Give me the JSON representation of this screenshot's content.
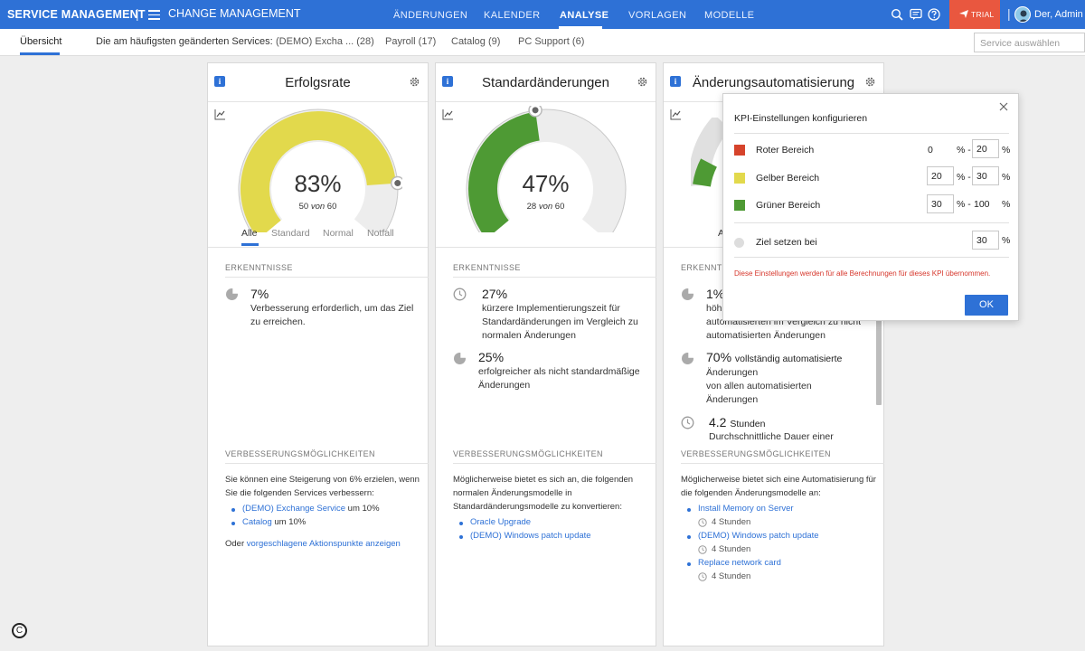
{
  "topbar": {
    "brand": "SERVICE MANAGEMENT",
    "separator": "|",
    "module": "CHANGE MANAGEMENT",
    "nav": [
      "ÄNDERUNGEN",
      "KALENDER",
      "ANALYSE",
      "VORLAGEN",
      "MODELLE"
    ],
    "trial": "TRIAL",
    "user": "Der, Admin",
    "accent_color": "#2e71d6",
    "trial_color": "#e9573f"
  },
  "subbar": {
    "overview": "Übersicht",
    "most_changed": "Die am häufigsten geänderten Services:",
    "services": [
      "(DEMO) Excha ... (28)",
      "Payroll (17)",
      "Catalog (9)",
      "PC Support (6)"
    ],
    "service_select_placeholder": "Service auswählen"
  },
  "cards": [
    {
      "title": "Erfolgsrate",
      "value": "83%",
      "ratio_a": "50",
      "ratio_von": "von",
      "ratio_b": "60",
      "fraction": 0.83,
      "gauge_color": "#e2d94c",
      "tabs": [
        "Alle",
        "Standard",
        "Normal",
        "Notfall"
      ],
      "insights_label": "ERKENNTNISSE",
      "insights": [
        {
          "icon": "pie-chart-icon",
          "big": "7%",
          "text": "Verbesserung erforderlich, um das Ziel zu erreichen."
        }
      ],
      "improve_label": "VERBESSERUNGSMÖGLICHKEITEN",
      "improve_text": "Sie können eine Steigerung von 6% erzielen, wenn Sie die folgenden Services verbessern:",
      "links": [
        {
          "text": "(DEMO) Exchange Service",
          "suffix": " um 10%"
        },
        {
          "text": "Catalog",
          "suffix": " um 10%"
        }
      ],
      "footer_prefix": "Oder ",
      "footer_link": "vorgeschlagene Aktionspunkte anzeigen"
    },
    {
      "title": "Standardänderungen",
      "value": "47%",
      "ratio_a": "28",
      "ratio_von": "von",
      "ratio_b": "60",
      "fraction": 0.47,
      "gauge_color": "#4e9a34",
      "insights_label": "ERKENNTNISSE",
      "insights": [
        {
          "icon": "clock-icon",
          "big": "27%",
          "text": "kürzere Implementierungszeit für Standardänderungen im Vergleich zu normalen Änderungen"
        },
        {
          "icon": "pie-chart-icon",
          "big": "25%",
          "text": "erfolgreicher als nicht standardmäßige Änderungen"
        }
      ],
      "improve_label": "VERBESSERUNGSMÖGLICHKEITEN",
      "improve_text": "Möglicherweise bietet es sich an, die folgenden normalen Änderungsmodelle in Standardänderungsmodelle zu konvertieren:",
      "links": [
        {
          "text": "Oracle Upgrade",
          "suffix": ""
        },
        {
          "text": "(DEMO) Windows patch update",
          "suffix": ""
        }
      ]
    },
    {
      "title": "Änderungsautomatisierung",
      "tab_partial": "A",
      "gauge_color": "#4e9a34",
      "insights_label": "ERKENNTNISSE",
      "insights": [
        {
          "icon": "pie-chart-icon",
          "big": "1%",
          "line1": "höhe",
          "line2": "automatisierten im Vergleich zu nicht",
          "line3": "automatisierten Änderungen"
        },
        {
          "icon": "pie-chart-icon",
          "big": "70%",
          "inline": "vollständig automatisierte",
          "line1": "Änderungen",
          "line2": "von allen automatisierten",
          "line3": "Änderungen"
        },
        {
          "icon": "clock-icon",
          "big": "4.2",
          "inline": "Stunden",
          "line1": "Durchschnittliche Dauer einer"
        }
      ],
      "improve_label": "VERBESSERUNGSMÖGLICHKEITEN",
      "improve_text": "Möglicherweise bietet sich eine Automatisierung für die folgenden Änderungsmodelle an:",
      "links": [
        {
          "text": "Install Memory on Server",
          "duration": "4 Stunden"
        },
        {
          "text": "(DEMO) Windows patch update",
          "duration": "4 Stunden"
        },
        {
          "text": "Replace network card",
          "duration": "4 Stunden"
        }
      ]
    }
  ],
  "popover": {
    "title": "KPI-Einstellungen konfigurieren",
    "rows": [
      {
        "label": "Roter Bereich",
        "from": "0",
        "to": "20",
        "color": "#d6432b"
      },
      {
        "label": "Gelber Bereich",
        "from": "20",
        "to": "30",
        "color": "#e2d94c"
      },
      {
        "label": "Grüner Bereich",
        "from": "30",
        "to": "100",
        "color": "#4e9a34"
      }
    ],
    "percent": "%",
    "percent_dash": "% -",
    "target_label": "Ziel setzen bei",
    "target_value": "30",
    "note": "Diese Einstellungen werden für alle Berechnungen für dieses KPI übernommen.",
    "ok": "OK"
  },
  "copyright_symbol": "C"
}
